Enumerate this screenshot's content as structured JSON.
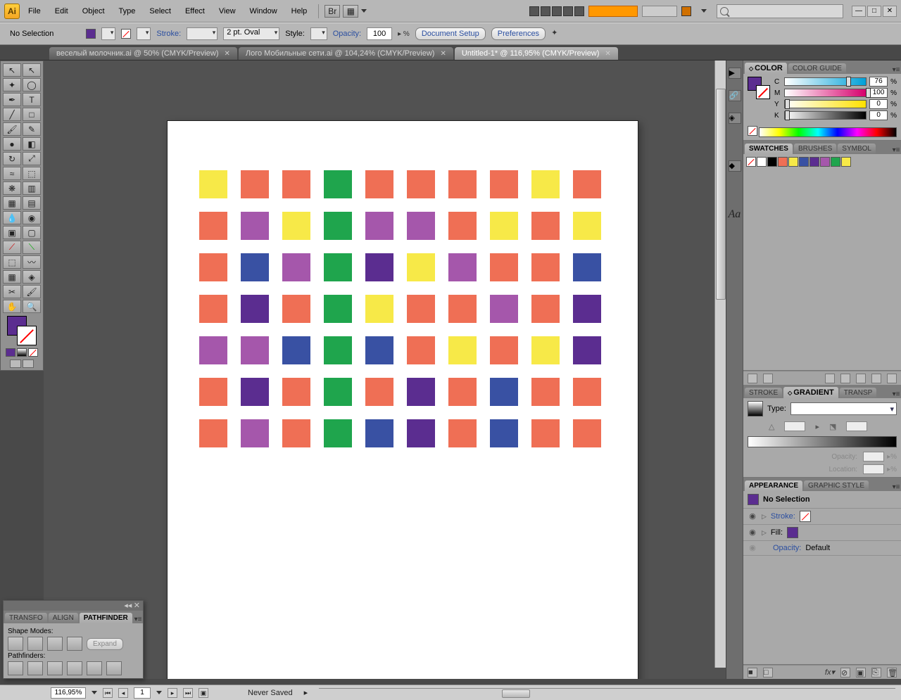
{
  "menubar": {
    "items": [
      "File",
      "Edit",
      "Object",
      "Type",
      "Select",
      "Effect",
      "View",
      "Window",
      "Help"
    ]
  },
  "controlbar": {
    "selection": "No Selection",
    "stroke_label": "Stroke:",
    "stroke_weight": "2 pt. Oval",
    "style_label": "Style:",
    "opacity_label": "Opacity:",
    "opacity_value": "100",
    "doc_setup": "Document Setup",
    "preferences": "Preferences"
  },
  "tabs": [
    {
      "label": "веселый молочник.ai @ 50% (CMYK/Preview)",
      "active": false
    },
    {
      "label": "Лого Мобильные сети.ai @ 104,24% (CMYK/Preview)",
      "active": false
    },
    {
      "label": "Untitled-1* @ 116,95% (CMYK/Preview)",
      "active": true
    }
  ],
  "canvas": {
    "colors": {
      "yellow": "#f7e948",
      "orange": "#ef6f55",
      "green": "#1fa54d",
      "purple": "#a557ab",
      "darkpurple": "#5b2d90",
      "blue": "#3951a3"
    },
    "grid": [
      [
        "yellow",
        "orange",
        "orange",
        "green",
        "orange",
        "orange",
        "orange",
        "orange",
        "yellow",
        "orange"
      ],
      [
        "orange",
        "purple",
        "yellow",
        "green",
        "purple",
        "purple",
        "orange",
        "yellow",
        "orange",
        "yellow"
      ],
      [
        "orange",
        "blue",
        "purple",
        "green",
        "darkpurple",
        "yellow",
        "purple",
        "orange",
        "orange",
        "blue"
      ],
      [
        "orange",
        "darkpurple",
        "orange",
        "green",
        "yellow",
        "orange",
        "orange",
        "purple",
        "orange",
        "darkpurple"
      ],
      [
        "purple",
        "purple",
        "blue",
        "green",
        "blue",
        "orange",
        "yellow",
        "orange",
        "yellow",
        "darkpurple"
      ],
      [
        "orange",
        "darkpurple",
        "orange",
        "green",
        "orange",
        "darkpurple",
        "orange",
        "blue",
        "orange",
        "orange"
      ],
      [
        "orange",
        "purple",
        "orange",
        "green",
        "blue",
        "darkpurple",
        "orange",
        "blue",
        "orange",
        "orange"
      ]
    ]
  },
  "color_panel": {
    "tabs": [
      "COLOR",
      "COLOR GUIDE"
    ],
    "channels": [
      {
        "ch": "C",
        "val": "76",
        "grad": "linear-gradient(90deg,#fff,#00a0d8)",
        "pos": 76
      },
      {
        "ch": "M",
        "val": "100",
        "grad": "linear-gradient(90deg,#fff,#d6006c)",
        "pos": 100
      },
      {
        "ch": "Y",
        "val": "0",
        "grad": "linear-gradient(90deg,#fff,#ffe100)",
        "pos": 0
      },
      {
        "ch": "K",
        "val": "0",
        "grad": "linear-gradient(90deg,#fff,#000)",
        "pos": 0
      }
    ]
  },
  "swatches_panel": {
    "tabs": [
      "SWATCHES",
      "BRUSHES",
      "SYMBOL"
    ],
    "swatches": [
      "#ffffff",
      "#000000",
      "#ef6f55",
      "#f7e948",
      "#3951a3",
      "#5b2d90",
      "#a557ab",
      "#1fa54d",
      "#f7e948"
    ]
  },
  "gradient_panel": {
    "tabs": [
      "STROKE",
      "GRADIENT",
      "TRANSP"
    ],
    "type_label": "Type:",
    "opacity_label": "Opacity:",
    "location_label": "Location:"
  },
  "appearance_panel": {
    "tabs": [
      "APPEARANCE",
      "GRAPHIC STYLE"
    ],
    "title": "No Selection",
    "stroke_label": "Stroke:",
    "fill_label": "Fill:",
    "opacity_label": "Opacity:",
    "opacity_value": "Default"
  },
  "pathfinder": {
    "tabs": [
      "TRANSFO",
      "ALIGN",
      "PATHFINDER"
    ],
    "shape_modes": "Shape Modes:",
    "expand": "Expand",
    "pathfinders": "Pathfinders:"
  },
  "status": {
    "zoom": "116,95%",
    "page": "1",
    "saved": "Never Saved"
  },
  "fill_color": "#5b2d90"
}
